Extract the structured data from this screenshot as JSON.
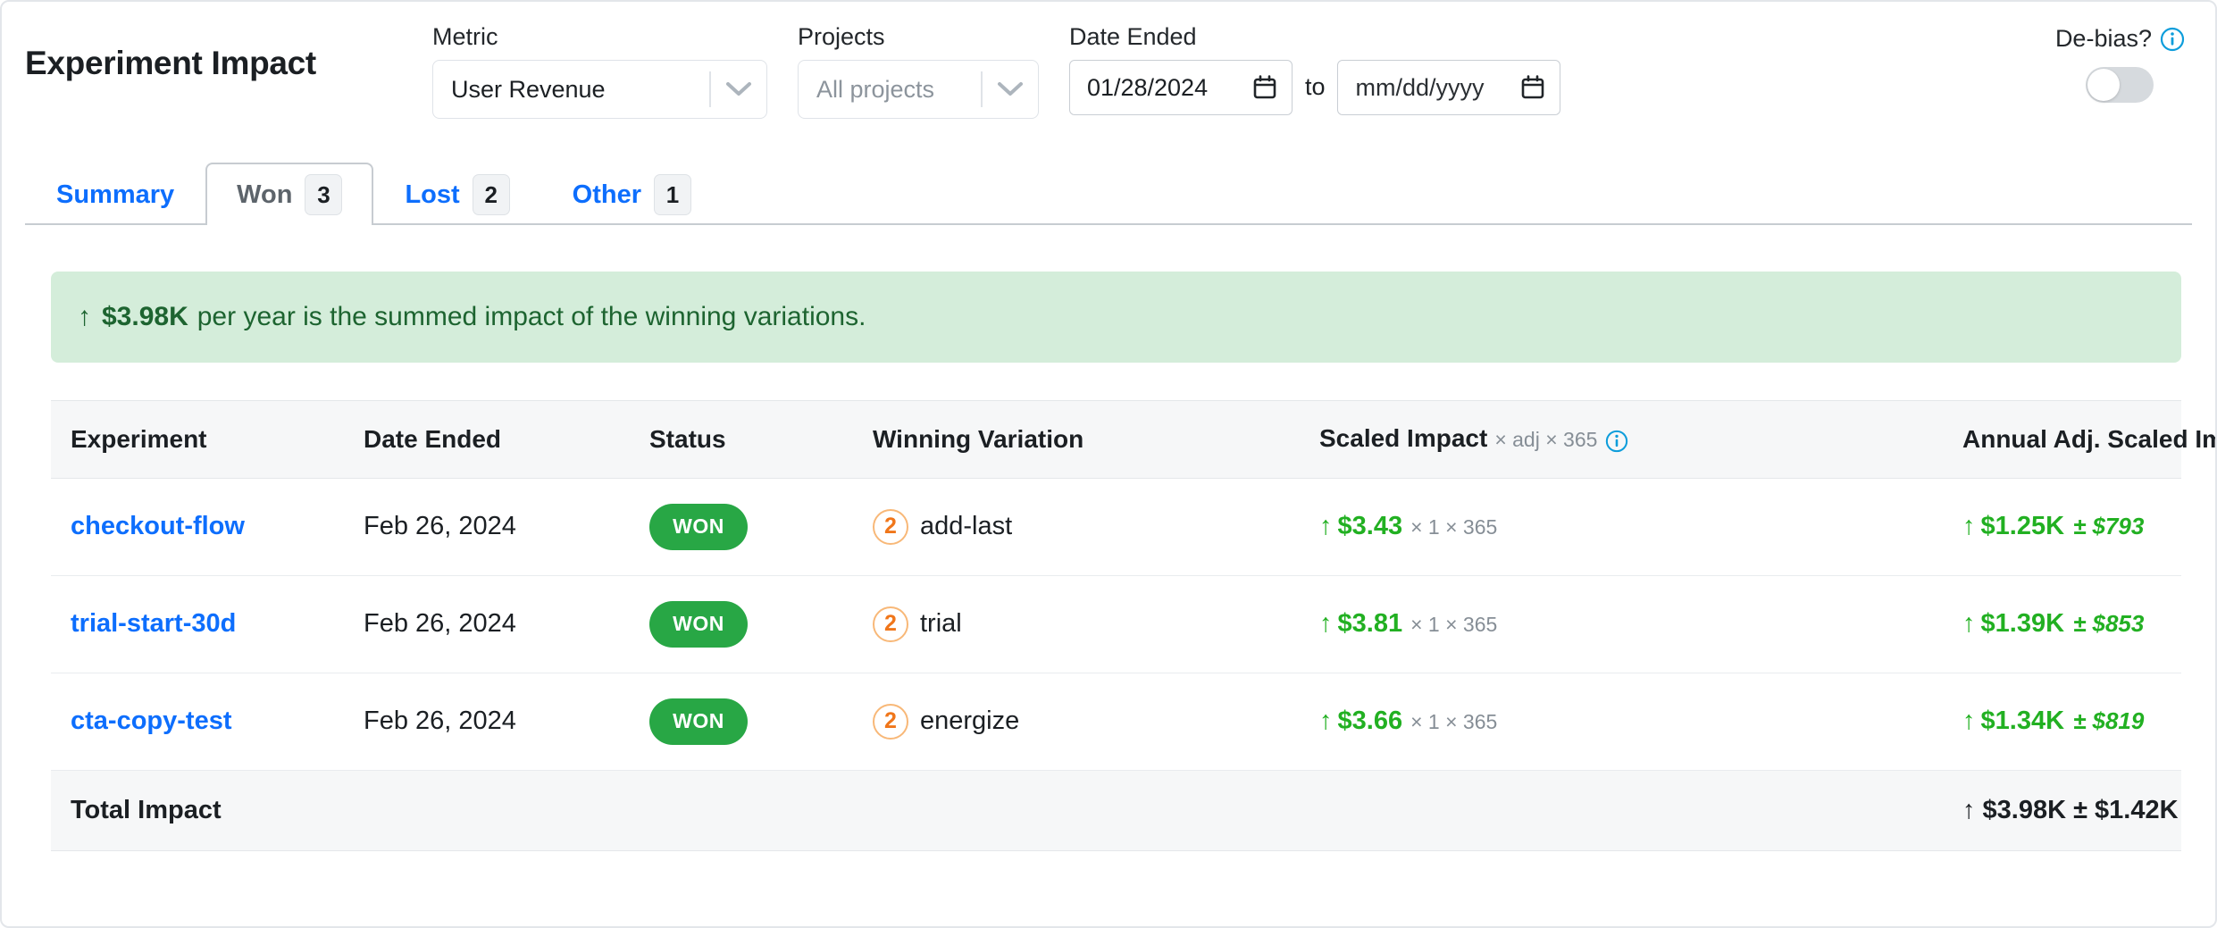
{
  "header": {
    "title": "Experiment Impact",
    "metric": {
      "label": "Metric",
      "value": "User Revenue",
      "icon": "chevron-down-icon"
    },
    "projects": {
      "label": "Projects",
      "placeholder": "All projects",
      "value": "All projects",
      "icon": "chevron-down-icon"
    },
    "date_ended": {
      "label": "Date Ended",
      "from_value": "01/28/2024",
      "to_word": "to",
      "to_value": "mm/dd/yyyy",
      "icon": "calendar-icon"
    },
    "debias": {
      "label": "De-bias?",
      "info_icon": "info-circle-icon",
      "toggle_on": false
    }
  },
  "tabs": [
    {
      "label": "Summary",
      "count": null,
      "active": false
    },
    {
      "label": "Won",
      "count": "3",
      "active": true
    },
    {
      "label": "Lost",
      "count": "2",
      "active": false
    },
    {
      "label": "Other",
      "count": "1",
      "active": false
    }
  ],
  "banner": {
    "arrow": "↑",
    "amount": "$3.98K",
    "text": "per year is the summed impact of the winning variations.",
    "bg_color": "#d4edda",
    "text_color": "#1d6430"
  },
  "table": {
    "columns": [
      {
        "label": "Experiment"
      },
      {
        "label": "Date Ended"
      },
      {
        "label": "Status"
      },
      {
        "label": "Winning Variation"
      },
      {
        "label": "Scaled Impact",
        "sub": "× adj × 365",
        "info_icon": "info-circle-icon"
      },
      {
        "label": "Annual Adj. Scaled Impact"
      }
    ],
    "rows": [
      {
        "experiment": "checkout-flow",
        "date_ended": "Feb 26, 2024",
        "status": "WON",
        "variation_number": "2",
        "variation_name": "add-last",
        "scaled_arrow": "↑",
        "scaled_impact": "$3.43",
        "scaled_mult": "× 1 × 365",
        "annual_arrow": "↑",
        "annual_impact": "$1.25K",
        "annual_ci": "± $793"
      },
      {
        "experiment": "trial-start-30d",
        "date_ended": "Feb 26, 2024",
        "status": "WON",
        "variation_number": "2",
        "variation_name": "trial",
        "scaled_arrow": "↑",
        "scaled_impact": "$3.81",
        "scaled_mult": "× 1 × 365",
        "annual_arrow": "↑",
        "annual_impact": "$1.39K",
        "annual_ci": "± $853"
      },
      {
        "experiment": "cta-copy-test",
        "date_ended": "Feb 26, 2024",
        "status": "WON",
        "variation_number": "2",
        "variation_name": "energize",
        "scaled_arrow": "↑",
        "scaled_impact": "$3.66",
        "scaled_mult": "× 1 × 365",
        "annual_arrow": "↑",
        "annual_impact": "$1.34K",
        "annual_ci": "± $819"
      }
    ],
    "footer": {
      "label": "Total Impact",
      "arrow": "↑",
      "total": "$3.98K ± $1.42K"
    }
  },
  "colors": {
    "link_blue": "#0d6efd",
    "won_green": "#28a745",
    "impact_green": "#22b022",
    "variation_orange": "#f0761a",
    "info_blue": "#0d9ddb"
  }
}
